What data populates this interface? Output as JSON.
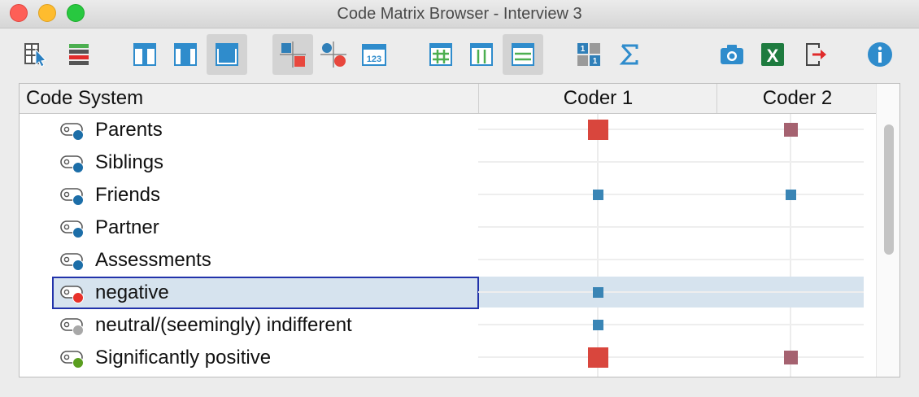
{
  "window": {
    "title": "Code Matrix Browser - Interview 3"
  },
  "toolbar": {
    "buttons": [
      {
        "name": "select-documents-button",
        "icon": "select-documents-icon",
        "active": false
      },
      {
        "name": "select-codes-button",
        "icon": "code-list-icon",
        "active": false
      },
      {
        "name": "column-narrow-button",
        "icon": "narrow-column-icon",
        "active": false
      },
      {
        "name": "column-medium-button",
        "icon": "medium-column-icon",
        "active": false
      },
      {
        "name": "column-wide-button",
        "icon": "wide-column-icon",
        "active": true
      },
      {
        "name": "symbols-squares-button",
        "icon": "squares-symbol-icon",
        "active": true
      },
      {
        "name": "symbols-circles-button",
        "icon": "circles-symbol-icon",
        "active": false
      },
      {
        "name": "show-numbers-button",
        "icon": "numbers-icon",
        "active": false
      },
      {
        "name": "grid-toggle-button",
        "icon": "grid-icon",
        "active": false
      },
      {
        "name": "vertical-lines-button",
        "icon": "vertical-lines-icon",
        "active": false
      },
      {
        "name": "horizontal-lines-button",
        "icon": "horizontal-lines-icon",
        "active": true
      },
      {
        "name": "binarize-button",
        "icon": "binarize-icon",
        "active": false
      },
      {
        "name": "sum-button",
        "icon": "sigma-icon",
        "active": false
      },
      {
        "name": "screenshot-button",
        "icon": "camera-icon",
        "active": false
      },
      {
        "name": "excel-export-button",
        "icon": "excel-icon",
        "active": false
      },
      {
        "name": "export-button",
        "icon": "export-icon",
        "active": false
      },
      {
        "name": "info-button",
        "icon": "info-icon",
        "active": false
      }
    ]
  },
  "table": {
    "headers": {
      "code_system": "Code System",
      "coder1": "Coder 1",
      "coder2": "Coder 2"
    },
    "rows": [
      {
        "label": "Parents",
        "dot_color": "#1c6ea8",
        "coder1": "large",
        "coder2": "medium"
      },
      {
        "label": "Siblings",
        "dot_color": "#1c6ea8",
        "coder1": "",
        "coder2": ""
      },
      {
        "label": "Friends",
        "dot_color": "#1c6ea8",
        "coder1": "small",
        "coder2": "small"
      },
      {
        "label": "Partner",
        "dot_color": "#1c6ea8",
        "coder1": "",
        "coder2": ""
      },
      {
        "label": "Assessments",
        "dot_color": "#1c6ea8",
        "coder1": "",
        "coder2": ""
      },
      {
        "label": "negative",
        "dot_color": "#e8312a",
        "coder1": "small",
        "coder2": "",
        "selected": true
      },
      {
        "label": "neutral/(seemingly) indifferent",
        "dot_color": "#a8a8a8",
        "coder1": "small",
        "coder2": ""
      },
      {
        "label": "Significantly positive",
        "dot_color": "#5a9e1f",
        "coder1": "large",
        "coder2": "medium"
      }
    ]
  },
  "colors": {
    "large_mark": "#d9463d",
    "medium_mark": "#a56270",
    "small_mark": "#3a85b5",
    "selection": "#d6e3ee",
    "selection_border": "#2233aa"
  }
}
